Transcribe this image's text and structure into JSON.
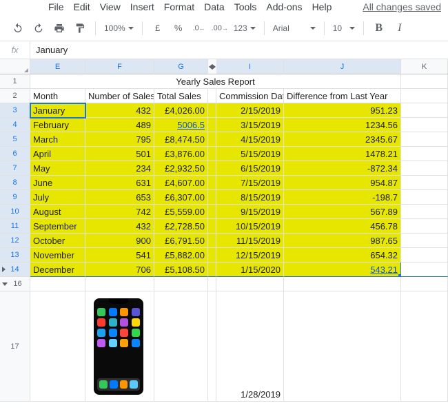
{
  "menu": {
    "items": [
      "File",
      "Edit",
      "View",
      "Insert",
      "Format",
      "Data",
      "Tools",
      "Add-ons",
      "Help"
    ],
    "status": "All changes saved"
  },
  "toolbar": {
    "zoom": "100%",
    "currency": "£",
    "percent": "%",
    "dec_dec": ".0",
    "dec_inc": ".00",
    "num_fmt": "123",
    "font": "Arial",
    "size": "10"
  },
  "formula_bar": {
    "fx": "fx",
    "value": "January"
  },
  "columns": [
    "E",
    "F",
    "G",
    "",
    "I",
    "J",
    "K"
  ],
  "title": "Yearly Sales Report",
  "headers": {
    "month": "Month",
    "num_sales": "Number of Sales",
    "total": "Total Sales",
    "commission": "Commission Date",
    "diff": "Difference from Last Year"
  },
  "rows": [
    {
      "r": "3",
      "month": "January",
      "num": "432",
      "total": "£4,026.00",
      "date": "2/15/2019",
      "diff": "951.23"
    },
    {
      "r": "4",
      "month": "February",
      "num": "489",
      "total": "5006.5",
      "date": "3/15/2019",
      "diff": "1234.56",
      "total_link": true
    },
    {
      "r": "5",
      "month": "March",
      "num": "795",
      "total": "£8,474.50",
      "date": "4/15/2019",
      "diff": "2345.67"
    },
    {
      "r": "6",
      "month": "April",
      "num": "501",
      "total": "£3,876.00",
      "date": "5/15/2019",
      "diff": "1478.21"
    },
    {
      "r": "7",
      "month": "May",
      "num": "234",
      "total": "£2,932.50",
      "date": "6/15/2019",
      "diff": "-872.34"
    },
    {
      "r": "8",
      "month": "June",
      "num": "631",
      "total": "£4,607.00",
      "date": "7/15/2019",
      "diff": "954.87"
    },
    {
      "r": "9",
      "month": "July",
      "num": "653",
      "total": "£6,307.00",
      "date": "8/15/2019",
      "diff": "-198.7"
    },
    {
      "r": "10",
      "month": "August",
      "num": "742",
      "total": "£5,559.00",
      "date": "9/15/2019",
      "diff": "567.89"
    },
    {
      "r": "11",
      "month": "September",
      "num": "432",
      "total": "£2,728.50",
      "date": "10/15/2019",
      "diff": "456.78"
    },
    {
      "r": "12",
      "month": "October",
      "num": "900",
      "total": "£6,791.50",
      "date": "11/15/2019",
      "diff": "987.65"
    },
    {
      "r": "13",
      "month": "November",
      "num": "541",
      "total": "£5,882.00",
      "date": "12/15/2019",
      "diff": "654.32"
    },
    {
      "r": "14",
      "month": "December",
      "num": "706",
      "total": "£5,108.50",
      "date": "1/15/2020",
      "diff": "543.21",
      "diff_link": true
    }
  ],
  "extra_rows": {
    "r16": "16",
    "r17": "17",
    "r17_date": "1/28/2019"
  }
}
